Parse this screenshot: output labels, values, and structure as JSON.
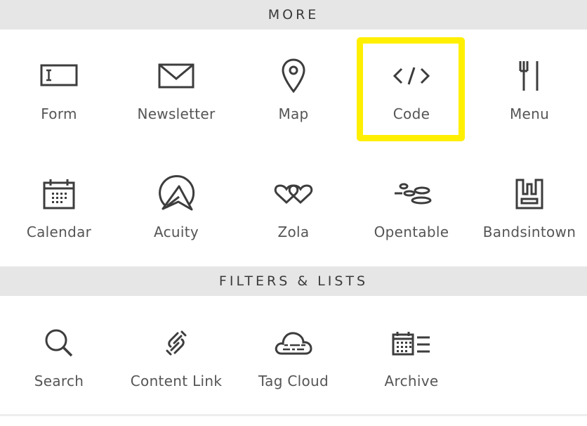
{
  "sections": [
    {
      "title": "MORE",
      "items": [
        {
          "label": "Form",
          "icon": "form-icon"
        },
        {
          "label": "Newsletter",
          "icon": "envelope-icon"
        },
        {
          "label": "Map",
          "icon": "map-pin-icon"
        },
        {
          "label": "Code",
          "icon": "code-icon"
        },
        {
          "label": "Menu",
          "icon": "fork-knife-icon"
        },
        {
          "label": "Calendar",
          "icon": "calendar-icon"
        },
        {
          "label": "Acuity",
          "icon": "acuity-icon"
        },
        {
          "label": "Zola",
          "icon": "hearts-icon"
        },
        {
          "label": "Opentable",
          "icon": "opentable-icon"
        },
        {
          "label": "Bandsintown",
          "icon": "bandsintown-icon"
        }
      ]
    },
    {
      "title": "FILTERS & LISTS",
      "items": [
        {
          "label": "Search",
          "icon": "search-icon"
        },
        {
          "label": "Content Link",
          "icon": "link-icon"
        },
        {
          "label": "Tag Cloud",
          "icon": "cloud-icon"
        },
        {
          "label": "Archive",
          "icon": "archive-icon"
        }
      ]
    }
  ],
  "highlighted_item": "Code",
  "colors": {
    "highlight": "#ffef00",
    "header_bg": "#e6e6e6",
    "icon": "#3d3d3d",
    "label": "#555555"
  }
}
